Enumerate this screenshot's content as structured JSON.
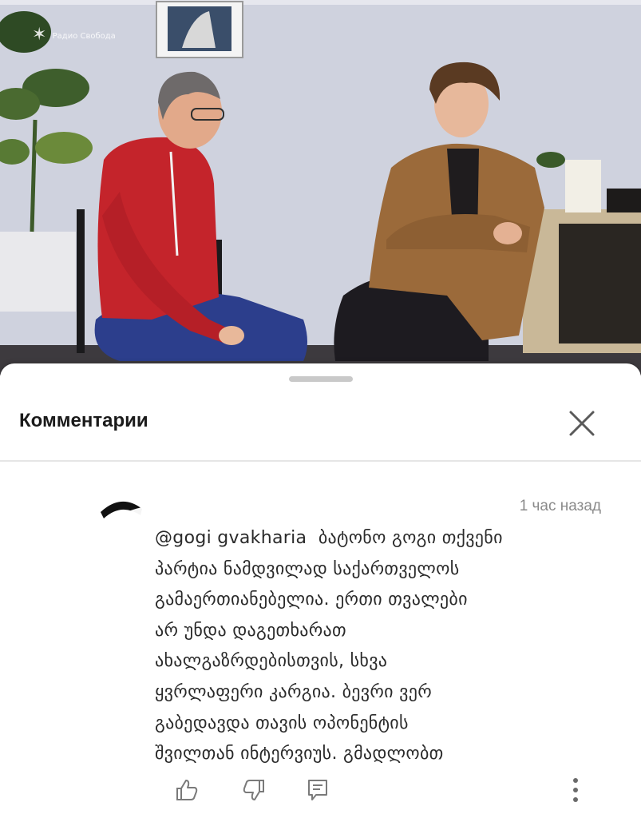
{
  "video": {
    "watermark_text": "Радио Свобода",
    "watermark_glyph": "✶"
  },
  "comments_sheet": {
    "title": "Комментарии",
    "close_icon": "close-icon"
  },
  "comment": {
    "timestamp": "1 час назад",
    "mention": "@gogi gvakharia",
    "lines": [
      "ბატონო გოგი თქვენი",
      "პარტია ნამდვილად საქართველოს",
      "გამაერთიანებელია. ერთი თვალები",
      "არ უნდა დაგეთხარათ",
      "ახალგაზრდებისთვის, სხვა",
      "ყვრლაფერი კარგია. ბევრი ვერ",
      "გაბედავდა თავის ოპონენტის",
      "შვილთან ინტერვიუს. გმადლობთ"
    ],
    "actions": [
      "like-icon",
      "dislike-icon",
      "reply-icon",
      "more-vert-icon"
    ]
  },
  "colors": {
    "text": "#2a2a2a",
    "muted": "#8a8a8a",
    "divider": "#e6e6e6"
  }
}
